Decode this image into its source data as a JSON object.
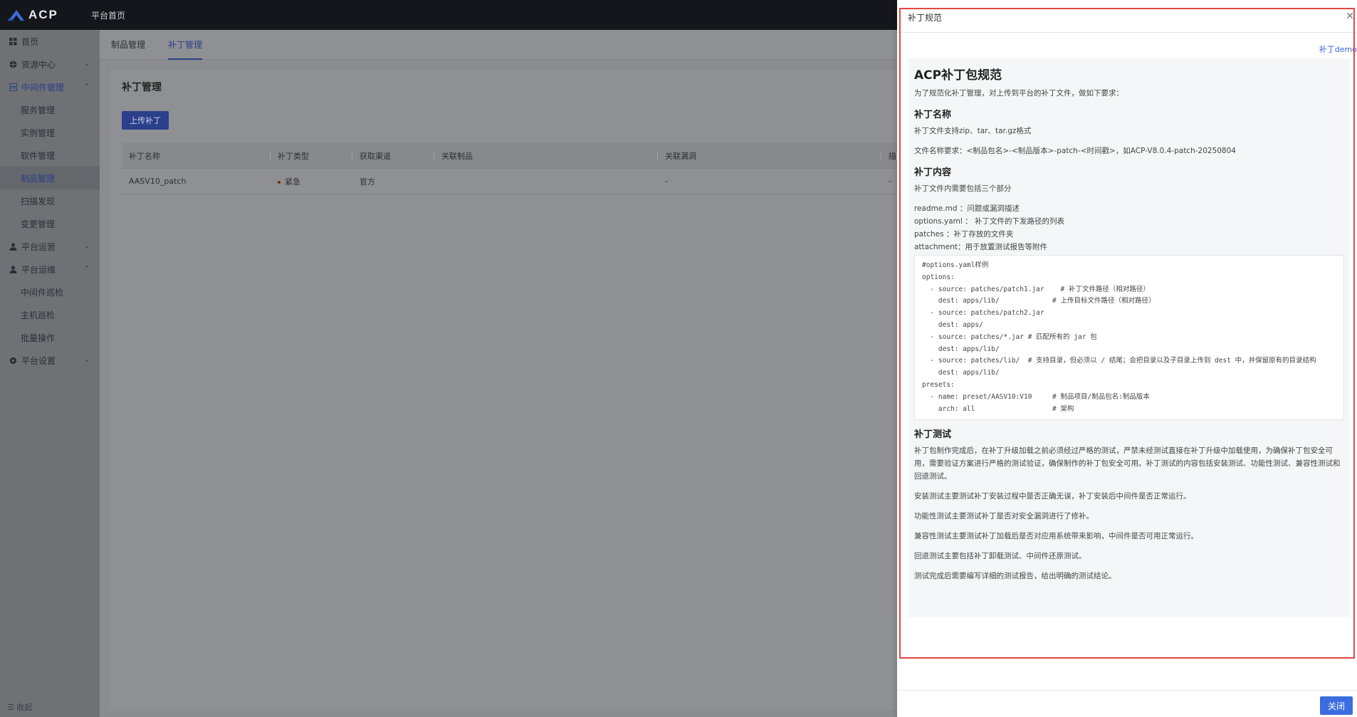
{
  "app": {
    "brand": "ACP",
    "top_nav": "平台首页"
  },
  "sidebar": {
    "items": [
      {
        "label": "首页"
      },
      {
        "label": "资源中心"
      },
      {
        "label": "中间件管理"
      },
      {
        "label": "服务管理"
      },
      {
        "label": "实例管理"
      },
      {
        "label": "软件管理"
      },
      {
        "label": "制品管理"
      },
      {
        "label": "扫描发现"
      },
      {
        "label": "变更管理"
      },
      {
        "label": "平台运营"
      },
      {
        "label": "平台运维"
      },
      {
        "label": "中间件巡检"
      },
      {
        "label": "主机巡检"
      },
      {
        "label": "批量操作"
      },
      {
        "label": "平台设置"
      }
    ],
    "collapse": "收起"
  },
  "tabs": [
    {
      "label": "制品管理"
    },
    {
      "label": "补丁管理"
    }
  ],
  "main": {
    "title": "补丁管理",
    "upload_label": "上传补丁",
    "table": {
      "headers": [
        "补丁名称",
        "补丁类型",
        "获取渠道",
        "关联制品",
        "关联漏洞",
        "描"
      ],
      "rows": [
        {
          "name": "AASV10_patch",
          "type": "紧急",
          "channel": "官方",
          "artifact": "",
          "vuln": "-",
          "desc": "-"
        }
      ]
    }
  },
  "drawer": {
    "title": "补丁规范",
    "demo_link": "补丁demo",
    "close_label": "关闭",
    "doc": {
      "h1": "ACP补丁包规范",
      "intro": "为了规范化补丁管理，对上传到平台的补丁文件，做如下要求：",
      "s1_title": "补丁名称",
      "s1_p1": "补丁文件支持zip、tar、tar.gz格式",
      "s1_p2": "文件名称要求：<制品包名>-<制品版本>-patch-<时间戳>，如ACP-V8.0.4-patch-20250804",
      "s2_title": "补丁内容",
      "s2_p1": "补丁文件内需要包括三个部分",
      "s2_l1": "readme.md ：问题或漏洞描述",
      "s2_l2": "options.yaml ： 补丁文件的下发路径的列表",
      "s2_l3": "patches ：补丁存放的文件夹",
      "s2_l4": "attachment：用于放置测试报告等附件",
      "code": "#options.yaml样例\noptions:\n  - source: patches/patch1.jar    # 补丁文件路径（相对路径）\n    dest: apps/lib/             # 上传目标文件路径（相对路径）\n  - source: patches/patch2.jar\n    dest: apps/\n  - source: patches/*.jar # 匹配所有的 jar 包\n    dest: apps/lib/\n  - source: patches/lib/  # 支持目录，但必须以 / 结尾；会把目录以及子目录上传到 dest 中，并保留原有的目录结构\n    dest: apps/lib/\npresets:\n  - name: preset/AASV10:V10     # 制品项目/制品包名:制品版本\n    arch: all                   # 架构",
      "s3_title": "补丁测试",
      "s3_p1": "补丁包制作完成后，在补丁升级加载之前必须经过严格的测试，严禁未经测试直接在补丁升级中加载使用，为确保补丁包安全可用，需要验证方案进行严格的测试验证，确保制作的补丁包安全可用。补丁测试的内容包括安装测试、功能性测试、兼容性测试和回退测试。",
      "s3_p2": "安装测试主要测试补丁安装过程中是否正确无误，补丁安装后中间件是否正常运行。",
      "s3_p3": "功能性测试主要测试补丁是否对安全漏洞进行了修补。",
      "s3_p4": "兼容性测试主要测试补丁加载后是否对应用系统带来影响，中间件是否可用正常运行。",
      "s3_p5": "回退测试主要包括补丁卸载测试、中间件还原测试。",
      "s3_p6": "测试完成后需要编写详细的测试报告，给出明确的测试结论。"
    }
  },
  "colors": {
    "accent": "#3b6de0",
    "highlight_frame": "#e0483f",
    "urgent": "#c0392b"
  }
}
